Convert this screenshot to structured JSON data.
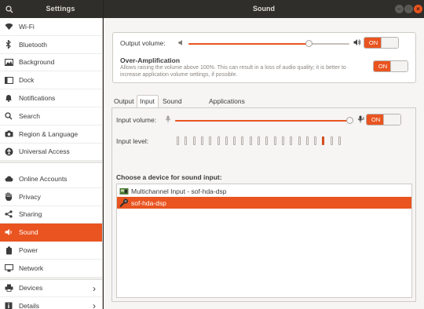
{
  "header": {
    "left_title": "Settings",
    "title": "Sound",
    "window_controls": {
      "minimize": "–",
      "maximize": "□",
      "close": "×"
    }
  },
  "sidebar": {
    "items": [
      {
        "label": "Wi-Fi",
        "icon": "wifi-icon"
      },
      {
        "label": "Bluetooth",
        "icon": "bluetooth-icon"
      },
      {
        "label": "Background",
        "icon": "background-icon"
      },
      {
        "label": "Dock",
        "icon": "dock-icon"
      },
      {
        "label": "Notifications",
        "icon": "bell-icon"
      },
      {
        "label": "Search",
        "icon": "search-icon"
      },
      {
        "label": "Region & Language",
        "icon": "camera-icon"
      },
      {
        "label": "Universal Access",
        "icon": "accessibility-icon"
      },
      {
        "label": "Online Accounts",
        "icon": "online-accounts-icon"
      },
      {
        "label": "Privacy",
        "icon": "hand-icon"
      },
      {
        "label": "Sharing",
        "icon": "share-icon"
      },
      {
        "label": "Sound",
        "icon": "speaker-icon",
        "active": true
      },
      {
        "label": "Power",
        "icon": "power-icon"
      },
      {
        "label": "Network",
        "icon": "network-icon"
      },
      {
        "label": "Devices",
        "icon": "printer-icon",
        "chevron": "›"
      },
      {
        "label": "Details",
        "icon": "info-icon",
        "chevron": "›"
      }
    ]
  },
  "output_volume": {
    "label": "Output volume:",
    "level": 0.75,
    "toggle": "ON"
  },
  "over_amplification": {
    "title": "Over-Amplification",
    "description_line1": "Allows raising the volume above 100%. This can result in a loss of audio quality; it is better to",
    "description_line2": "increase application volume settings, if possible.",
    "toggle": "ON"
  },
  "tabs": [
    "Output",
    "Input",
    "Sound Effects",
    "Applications"
  ],
  "active_tab": "Input",
  "input": {
    "volume_label": "Input volume:",
    "volume_level": 0.98,
    "toggle": "ON",
    "level_label": "Input level:",
    "level_segments": 21,
    "level_lit_index": 18,
    "choose_label": "Choose a device for sound input:",
    "devices": [
      {
        "name": "Multichannel Input - sof-hda-dsp",
        "selected": false
      },
      {
        "name": "sof-hda-dsp",
        "selected": true
      }
    ]
  },
  "colors": {
    "accent": "#e95420",
    "header": "#2f2e2b",
    "sidebar": "#ffffff"
  }
}
